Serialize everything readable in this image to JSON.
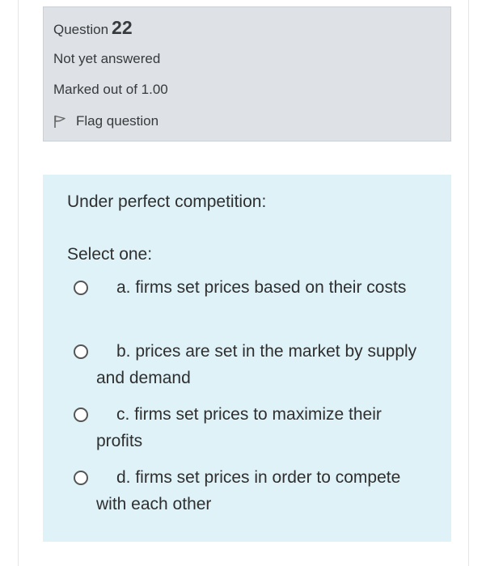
{
  "question_info": {
    "question_label": "Question",
    "question_number": "22",
    "state": "Not yet answered",
    "grade": "Marked out of 1.00",
    "flag_label": "Flag question",
    "flag_icon": "flag-icon"
  },
  "question": {
    "text": "Under perfect competition:",
    "prompt": "Select one:",
    "options": [
      {
        "label": "a. firms set prices based on their costs",
        "selected": false
      },
      {
        "label": "b. prices are set in the market by supply and demand",
        "selected": false
      },
      {
        "label": "c. firms set prices to maximize their profits",
        "selected": false
      },
      {
        "label": "d. firms set prices in order to compete with each other",
        "selected": false
      }
    ]
  },
  "colors": {
    "info_background": "#dee2e6",
    "content_background": "#def2f8",
    "text": "#373a3c"
  }
}
